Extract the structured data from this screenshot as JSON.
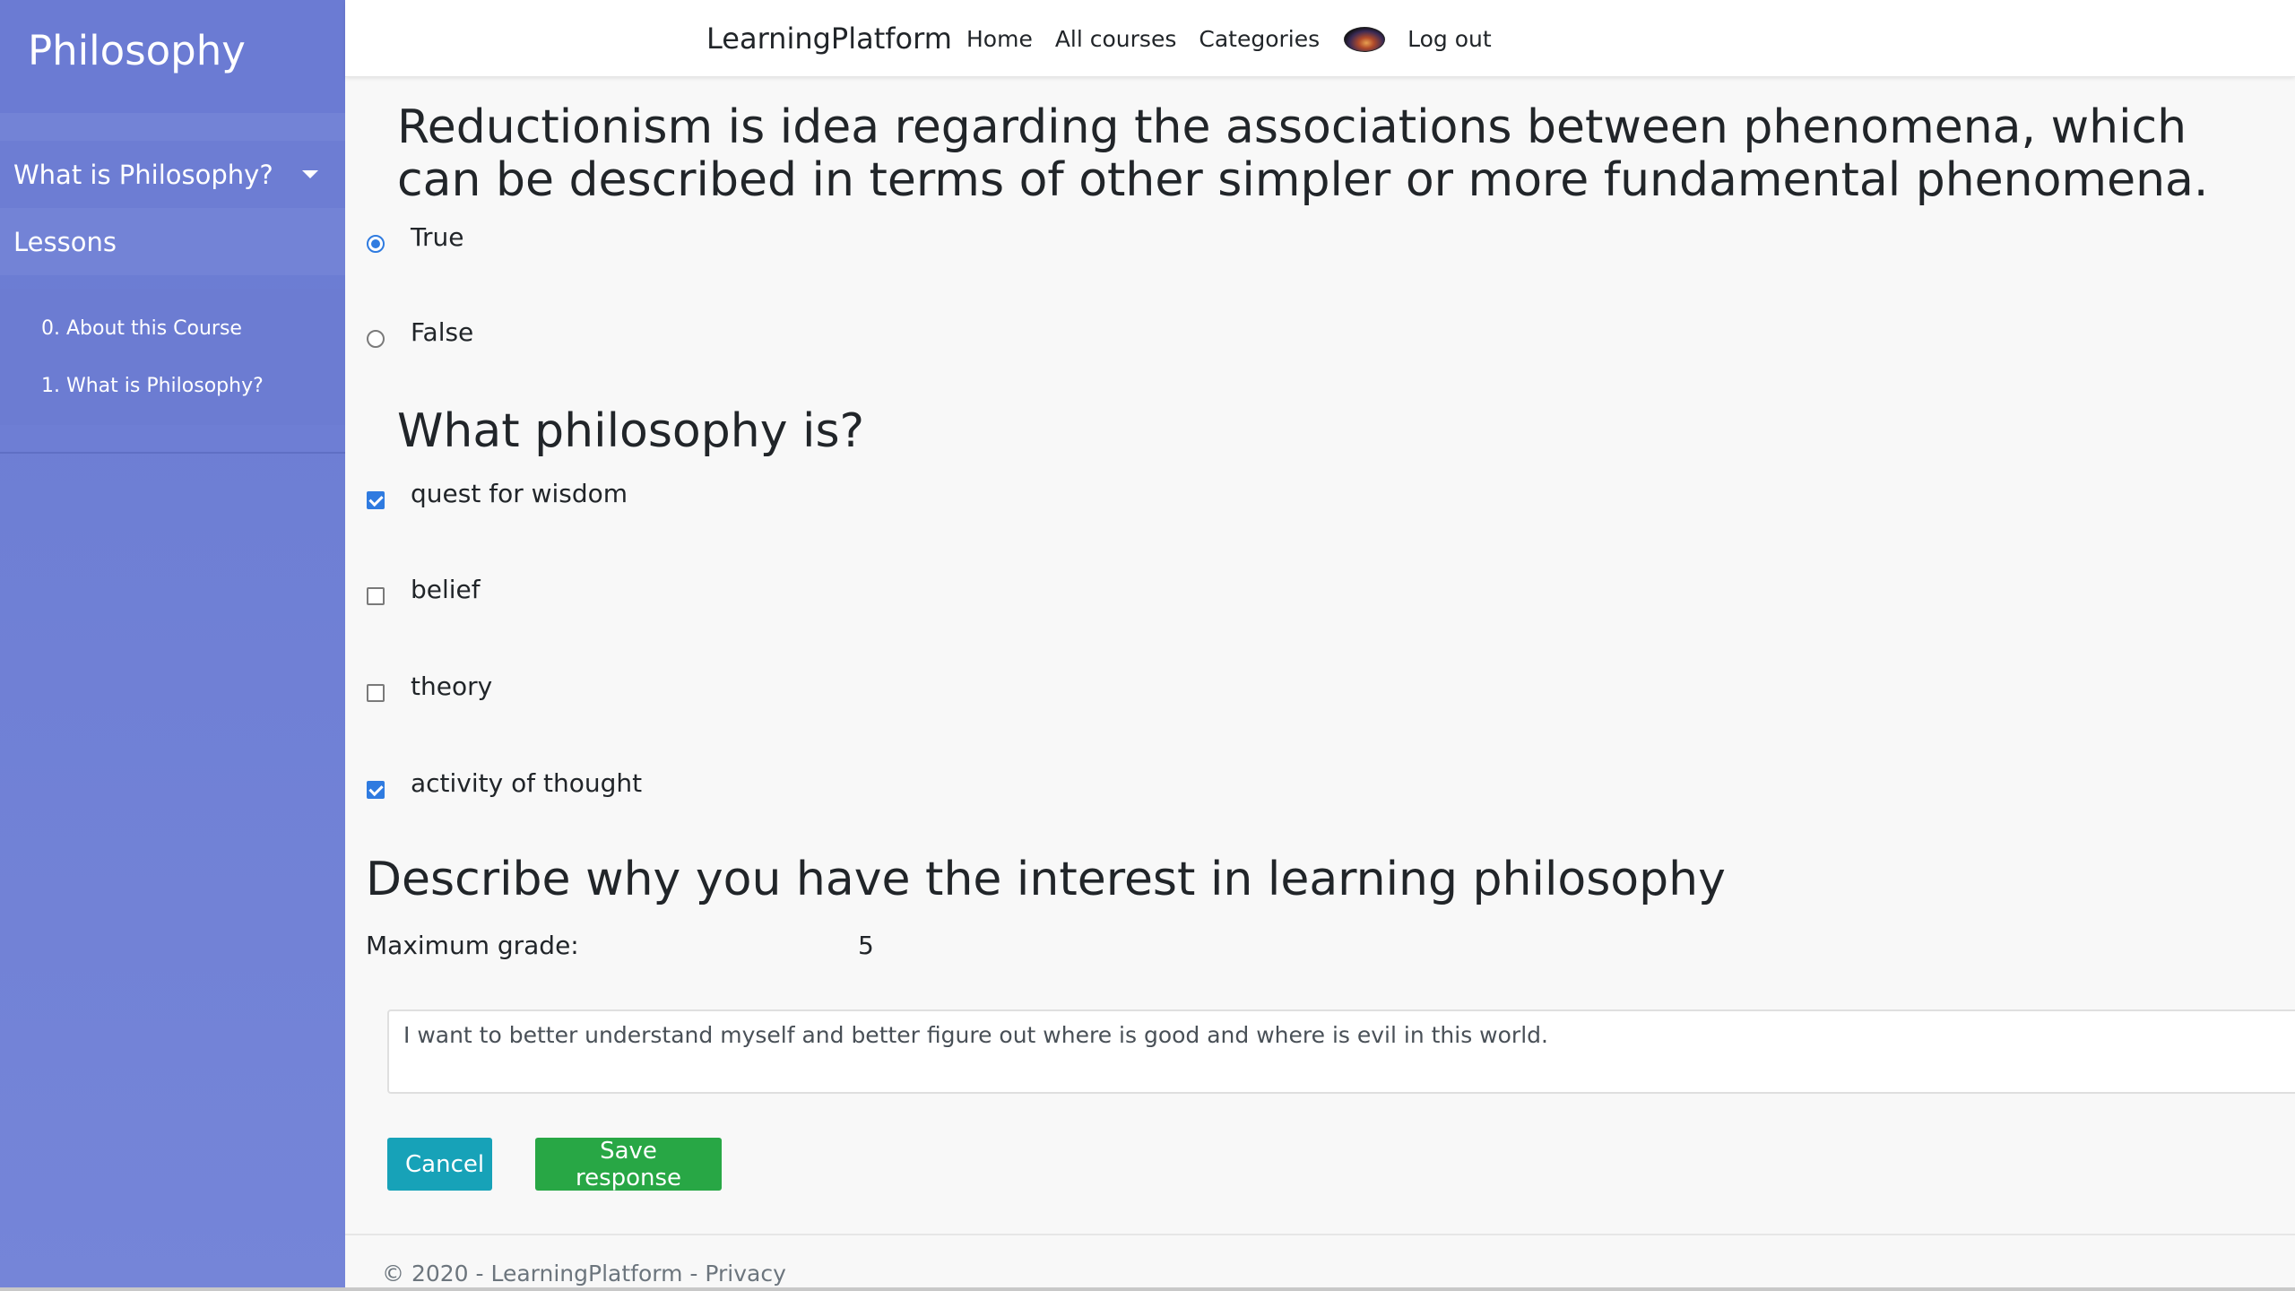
{
  "sidebar": {
    "title": "Philosophy",
    "section": "What is Philosophy?",
    "lessons_label": "Lessons",
    "lessons": [
      "0. About this Course",
      "1. What is Philosophy?"
    ]
  },
  "navbar": {
    "brand": "LearningPlatform",
    "links": [
      "Home",
      "All courses",
      "Categories"
    ],
    "logout": "Log out"
  },
  "questions": [
    {
      "title": "Reductionism is idea regarding the associations between phenomena, which can be described in terms of other simpler or more fundamental phenomena.",
      "type": "radio",
      "options": [
        {
          "label": "True",
          "checked": true
        },
        {
          "label": "False",
          "checked": false
        }
      ]
    },
    {
      "title": "What philosophy is?",
      "type": "checkbox",
      "options": [
        {
          "label": "quest for wisdom",
          "checked": true
        },
        {
          "label": "belief",
          "checked": false
        },
        {
          "label": "theory",
          "checked": false
        },
        {
          "label": "activity of thought",
          "checked": true
        }
      ]
    },
    {
      "title": "Describe why you have the interest in learning philosophy",
      "type": "text",
      "max_grade_label": "Maximum grade:",
      "max_grade_value": "5",
      "response": "I want to better understand myself and better figure out where is good and where is evil in this world."
    }
  ],
  "buttons": {
    "cancel": "Cancel",
    "save": "Save response"
  },
  "footer": {
    "text": "© 2020 - LearningPlatform - ",
    "privacy": "Privacy"
  },
  "colors": {
    "sidebar": "#6b7bd3",
    "accent": "#2f7be0",
    "cancel": "#17a2b8",
    "save": "#28a745"
  }
}
